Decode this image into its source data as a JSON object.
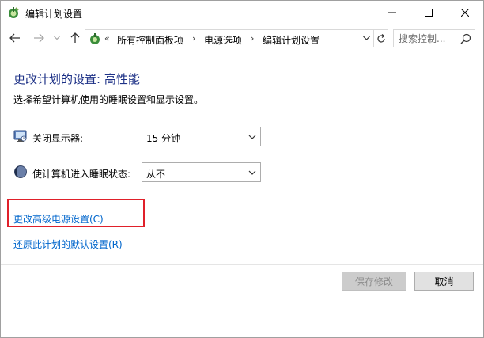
{
  "window": {
    "title": "编辑计划设置",
    "icon": "power-options-icon"
  },
  "nav": {
    "crumb_separator": "«",
    "crumbs": [
      "所有控制面板项",
      "电源选项",
      "编辑计划设置"
    ],
    "crumb_arrow": "›",
    "search_placeholder": "搜索控制..."
  },
  "content": {
    "heading": "更改计划的设置: 高性能",
    "subtitle": "选择希望计算机使用的睡眠设置和显示设置。",
    "settings": [
      {
        "label": "关闭显示器:",
        "value": "15 分钟",
        "icon": "display-icon"
      },
      {
        "label": "使计算机进入睡眠状态:",
        "value": "从不",
        "icon": "sleep-moon-icon"
      }
    ],
    "links": {
      "advanced": "更改高级电源设置(C)",
      "restore": "还原此计划的默认设置(R)"
    }
  },
  "buttons": {
    "save": "保存修改",
    "cancel": "取消"
  },
  "colors": {
    "heading": "#1e3287",
    "link": "#0066cc",
    "highlight": "#e0202a"
  }
}
